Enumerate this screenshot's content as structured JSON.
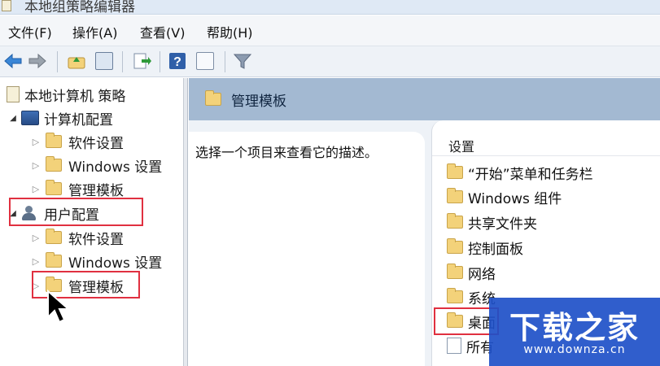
{
  "window": {
    "title": "本地组策略编辑器"
  },
  "menu": [
    {
      "label": "文件(F)"
    },
    {
      "label": "操作(A)"
    },
    {
      "label": "查看(V)"
    },
    {
      "label": "帮助(H)"
    }
  ],
  "toolbar": {
    "icons": [
      "back-arrow-icon",
      "forward-arrow-icon",
      "up-folder-icon",
      "show-hide-tree-icon",
      "export-list-icon",
      "help-icon",
      "show-hide-action-pane-icon",
      "filter-icon"
    ]
  },
  "tree": {
    "root": {
      "label": "本地计算机 策略"
    },
    "computer_config": {
      "label": "计算机配置",
      "children": [
        {
          "label": "软件设置"
        },
        {
          "label": "Windows 设置"
        },
        {
          "label": "管理模板"
        }
      ]
    },
    "user_config": {
      "label": "用户配置",
      "children": [
        {
          "label": "软件设置"
        },
        {
          "label": "Windows 设置"
        },
        {
          "label": "管理模板"
        }
      ]
    }
  },
  "main": {
    "header_title": "管理模板",
    "description": "选择一个项目来查看它的描述。",
    "column_header": "设置",
    "items": [
      {
        "label": "“开始”菜单和任务栏"
      },
      {
        "label": "Windows 组件"
      },
      {
        "label": "共享文件夹"
      },
      {
        "label": "控制面板"
      },
      {
        "label": "网络"
      },
      {
        "label": "系统"
      },
      {
        "label": "桌面"
      },
      {
        "label": "所有"
      }
    ]
  },
  "watermark": {
    "title": "下载之家",
    "url": "www.downza.cn"
  },
  "colors": {
    "highlight": "#e03040",
    "header_band": "#a3b9d2",
    "watermark_bg": "#1e50c8"
  }
}
